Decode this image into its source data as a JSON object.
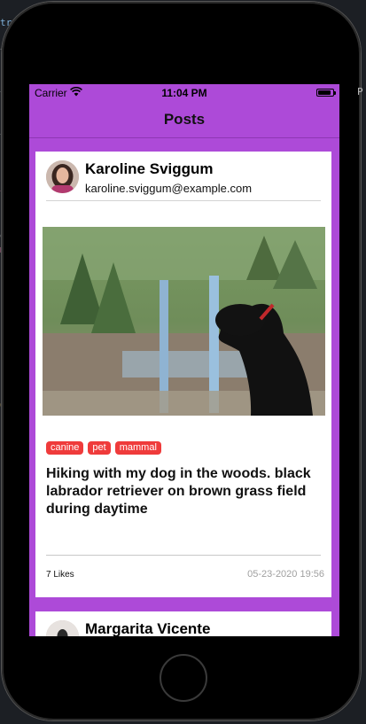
{
  "status_bar": {
    "carrier": "Carrier",
    "time": "11:04 PM",
    "battery_level": 0.9
  },
  "navbar": {
    "title": "Posts"
  },
  "posts": [
    {
      "user_name": "Karoline Sviggum",
      "user_email": "karoline.sviggum@example.com",
      "tags": [
        "canine",
        "pet",
        "mammal"
      ],
      "text": "Hiking with my dog in the woods. black labrador retriever on brown grass field during daytime",
      "likes": "7 Likes",
      "date": "05-23-2020 19:56"
    },
    {
      "user_name": "Margarita Vicente"
    }
  ],
  "colors": {
    "app_background": "#ad4ad8",
    "tag": "#ef3b3b"
  }
}
